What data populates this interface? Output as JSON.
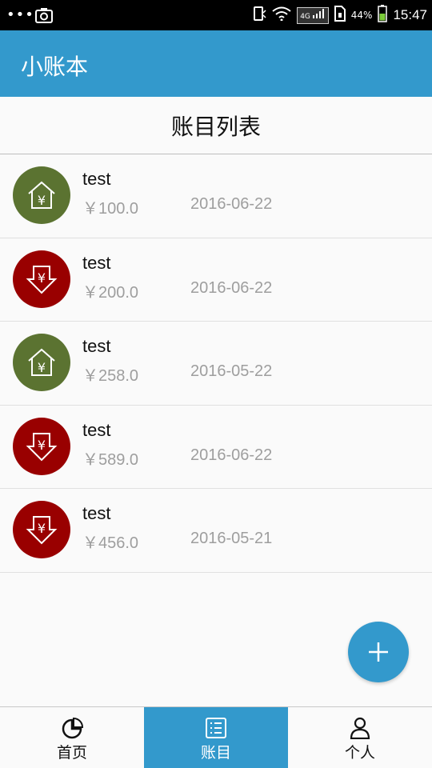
{
  "status_bar": {
    "dots": "•••",
    "network": "4G",
    "battery": "44%",
    "time": "15:47"
  },
  "app_bar": {
    "title": "小账本"
  },
  "section": {
    "title": "账目列表"
  },
  "records": [
    {
      "type": "income",
      "icon": "house-yuan-icon",
      "name": "test",
      "amount": "￥100.0",
      "date": "2016-06-22"
    },
    {
      "type": "expense",
      "icon": "arrow-down-yuan-icon",
      "name": "test",
      "amount": "￥200.0",
      "date": "2016-06-22"
    },
    {
      "type": "income",
      "icon": "house-yuan-icon",
      "name": "test",
      "amount": "￥258.0",
      "date": "2016-05-22"
    },
    {
      "type": "expense",
      "icon": "arrow-down-yuan-icon",
      "name": "test",
      "amount": "￥589.0",
      "date": "2016-06-22"
    },
    {
      "type": "expense",
      "icon": "arrow-down-yuan-icon",
      "name": "test",
      "amount": "￥456.0",
      "date": "2016-05-21"
    }
  ],
  "nav": {
    "items": [
      {
        "label": "首页",
        "icon": "pie-chart-icon",
        "active": false
      },
      {
        "label": "账目",
        "icon": "list-icon",
        "active": true
      },
      {
        "label": "个人",
        "icon": "person-icon",
        "active": false
      }
    ]
  },
  "colors": {
    "accent": "#3399cc",
    "income": "#5b7331",
    "expense": "#990000"
  }
}
